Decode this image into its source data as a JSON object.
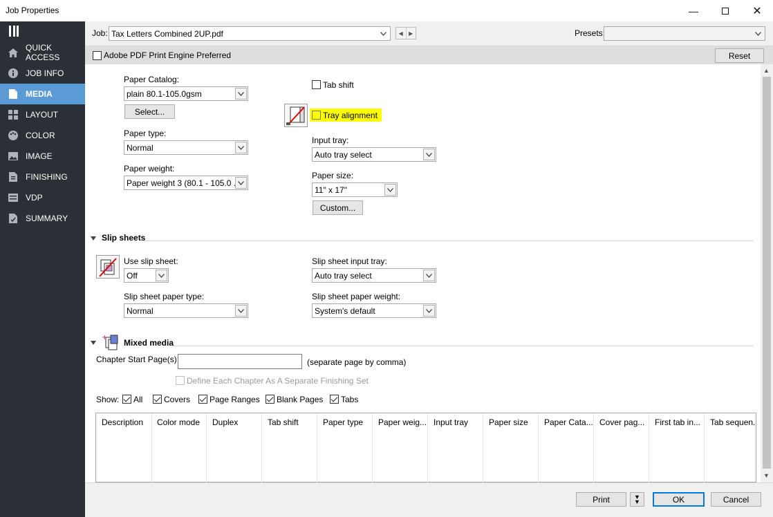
{
  "window": {
    "title": "Job Properties"
  },
  "sidebar": {
    "items": [
      {
        "label": "QUICK ACCESS",
        "icon": "home-icon"
      },
      {
        "label": "JOB INFO",
        "icon": "info-icon"
      },
      {
        "label": "MEDIA",
        "icon": "document-icon",
        "active": true
      },
      {
        "label": "LAYOUT",
        "icon": "layout-icon"
      },
      {
        "label": "COLOR",
        "icon": "palette-icon"
      },
      {
        "label": "IMAGE",
        "icon": "image-icon"
      },
      {
        "label": "FINISHING",
        "icon": "finishing-icon"
      },
      {
        "label": "VDP",
        "icon": "vdp-icon"
      },
      {
        "label": "SUMMARY",
        "icon": "summary-icon"
      }
    ]
  },
  "header": {
    "job_label": "Job:",
    "job_value": "Tax Letters Combined 2UP.pdf",
    "presets_label": "Presets:",
    "presets_value": ""
  },
  "pdfbar": {
    "engine_label": "Adobe PDF Print Engine Preferred",
    "reset_label": "Reset"
  },
  "media": {
    "paper_catalog_label": "Paper Catalog:",
    "paper_catalog_value": "plain 80.1-105.0gsm",
    "select_button": "Select...",
    "paper_type_label": "Paper type:",
    "paper_type_value": "Normal",
    "paper_weight_label": "Paper weight:",
    "paper_weight_value": "Paper weight 3 (80.1 - 105.0 ...",
    "tab_shift_label": "Tab shift",
    "tray_alignment_label": "Tray alignment",
    "input_tray_label": "Input tray:",
    "input_tray_value": "Auto tray select",
    "paper_size_label": "Paper size:",
    "paper_size_value": "11\" x 17\"",
    "custom_button": "Custom..."
  },
  "slip_sheets": {
    "title": "Slip sheets",
    "use_label": "Use slip sheet:",
    "use_value": "Off",
    "input_tray_label": "Slip sheet input tray:",
    "input_tray_value": "Auto tray select",
    "paper_type_label": "Slip sheet paper type:",
    "paper_type_value": "Normal",
    "paper_weight_label": "Slip sheet paper weight:",
    "paper_weight_value": "System's default"
  },
  "mixed_media": {
    "title": "Mixed media",
    "chapter_label": "Chapter Start Page(s):",
    "chapter_value": "",
    "chapter_hint": "(separate page by comma)",
    "define_label": "Define Each Chapter As A Separate Finishing Set",
    "show_label": "Show:",
    "filters": [
      {
        "label": "All",
        "checked": true
      },
      {
        "label": "Covers",
        "checked": true
      },
      {
        "label": "Page Ranges",
        "checked": true
      },
      {
        "label": "Blank Pages",
        "checked": true
      },
      {
        "label": "Tabs",
        "checked": true
      }
    ],
    "columns": [
      "Description",
      "Color mode",
      "Duplex",
      "Tab shift",
      "Paper type",
      "Paper weig...",
      "Input tray",
      "Paper size",
      "Paper Cata...",
      "Cover pag...",
      "First tab in...",
      "Tab sequen..."
    ]
  },
  "footer": {
    "print_label": "Print",
    "ok_label": "OK",
    "cancel_label": "Cancel"
  },
  "colors": {
    "sidebar_bg": "#2b2f36",
    "sidebar_active": "#5b9bd5",
    "highlight": "#ffff00",
    "ok_border": "#0078d7"
  }
}
